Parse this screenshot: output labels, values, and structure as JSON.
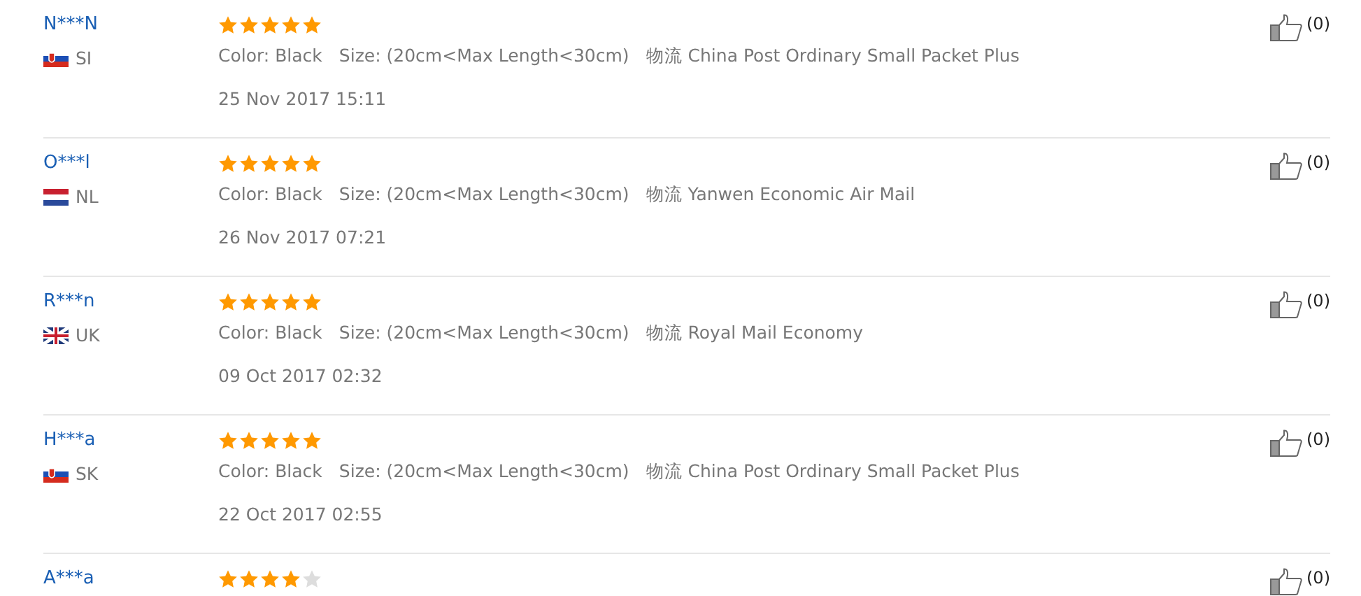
{
  "reviews": [
    {
      "name": "N***N",
      "flag": {
        "kind": "shield"
      },
      "country": "SI",
      "stars": 5,
      "color_label": "Color: Black",
      "size_label": "Size: (20cm<Max Length<30cm)",
      "shipping": "物流 China Post Ordinary Small Packet Plus",
      "date": "25 Nov 2017 15:11",
      "likes": "(0)"
    },
    {
      "name": "O***l",
      "flag": {
        "kind": "plain"
      },
      "country": "NL",
      "stars": 5,
      "color_label": "Color: Black",
      "size_label": "Size: (20cm<Max Length<30cm)",
      "shipping": "物流 Yanwen Economic Air Mail",
      "date": "26 Nov 2017 07:21",
      "likes": "(0)"
    },
    {
      "name": "R***n",
      "flag": {
        "kind": "union"
      },
      "country": "UK",
      "stars": 5,
      "color_label": "Color: Black",
      "size_label": "Size: (20cm<Max Length<30cm)",
      "shipping": "物流 Royal Mail Economy",
      "date": "09 Oct 2017 02:32",
      "likes": "(0)"
    },
    {
      "name": "H***a",
      "flag": {
        "kind": "shield"
      },
      "country": "SK",
      "stars": 5,
      "color_label": "Color: Black",
      "size_label": "Size: (20cm<Max Length<30cm)",
      "shipping": "物流 China Post Ordinary Small Packet Plus",
      "date": "22 Oct 2017 02:55",
      "likes": "(0)"
    },
    {
      "name": "A***a",
      "stars": 4,
      "likes": "(0)"
    }
  ]
}
